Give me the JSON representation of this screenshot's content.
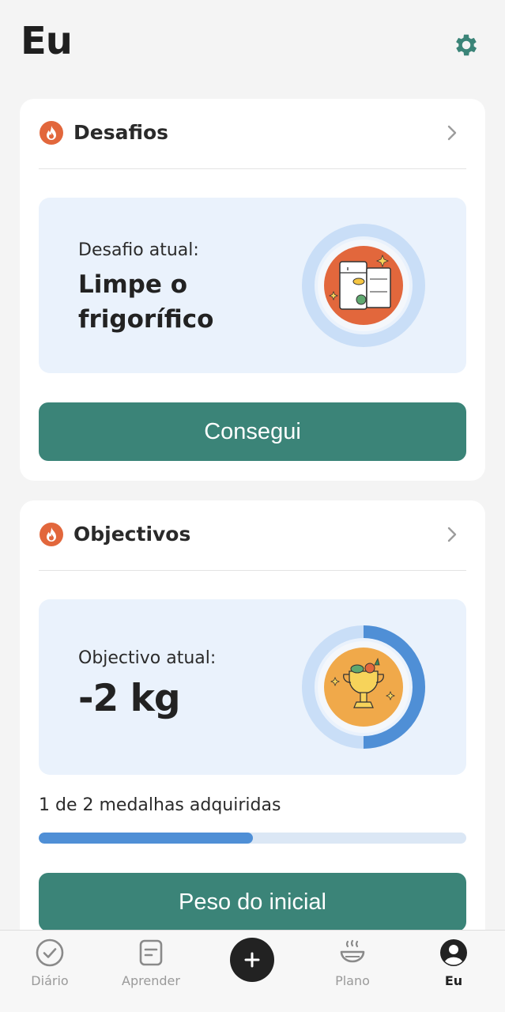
{
  "header": {
    "title": "Eu",
    "settings_icon": "gear-icon"
  },
  "challenges": {
    "title": "Desafios",
    "current_label": "Desafio atual:",
    "current_name": "Limpe o frigorífico",
    "button_label": "Consegui",
    "icon": "flame-icon",
    "illustration": "fridge-illustration"
  },
  "goals": {
    "title": "Objectivos",
    "current_label": "Objectivo atual:",
    "current_value": "-2 kg",
    "medals_text": "1 de 2 medalhas adquiridas",
    "medals_earned": 1,
    "medals_total": 2,
    "progress_fraction": 0.5,
    "button_label": "Peso do inicial",
    "icon": "flame-icon",
    "illustration": "trophy-illustration"
  },
  "tabbar": {
    "items": [
      {
        "label": "Diário",
        "icon": "check-circle-icon",
        "active": false
      },
      {
        "label": "Aprender",
        "icon": "notebook-icon",
        "active": false
      },
      {
        "label": "Plano",
        "icon": "bowl-icon",
        "active": false
      },
      {
        "label": "Eu",
        "icon": "profile-icon",
        "active": true
      }
    ],
    "add_icon": "plus-icon"
  },
  "colors": {
    "accent_green": "#3b8478",
    "flame_orange": "#e2673c",
    "panel_blue": "#eaf2fc",
    "progress_blue": "#4f8fd6",
    "ring_light": "#c9def7"
  }
}
